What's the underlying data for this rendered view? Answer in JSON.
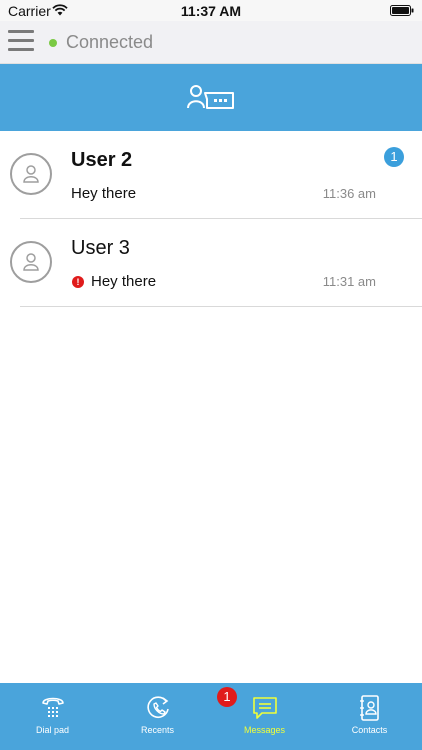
{
  "status_bar": {
    "carrier": "Carrier",
    "time": "11:37 AM"
  },
  "connection": {
    "status": "Connected",
    "status_color": "#7ac943"
  },
  "header": {
    "accent_color": "#4aa4db",
    "action_icon": "new-chat-icon"
  },
  "conversations": [
    {
      "name": "User 2",
      "preview": "Hey there",
      "time": "11:36 am",
      "unread": "1",
      "error": false
    },
    {
      "name": "User 3",
      "preview": "Hey there",
      "time": "11:31 am",
      "unread": "",
      "error": true,
      "error_glyph": "!"
    }
  ],
  "tabs": [
    {
      "label": "Dial pad",
      "icon": "dial-pad-icon",
      "active": false
    },
    {
      "label": "Recents",
      "icon": "recents-icon",
      "active": false
    },
    {
      "label": "Messages",
      "icon": "messages-icon",
      "active": true,
      "badge": "1"
    },
    {
      "label": "Contacts",
      "icon": "contacts-icon",
      "active": false
    }
  ]
}
